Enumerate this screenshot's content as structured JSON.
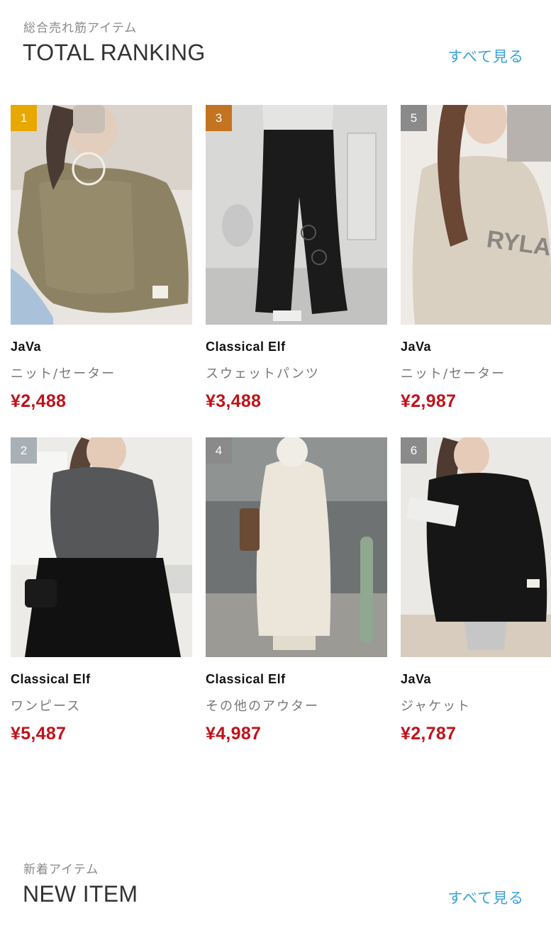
{
  "ranking": {
    "subtitle": "総合売れ筋アイテム",
    "title": "TOTAL RANKING",
    "see_all": "すべて見る",
    "products": [
      {
        "rank": "1",
        "rank_color": "#e8a800",
        "brand": "JaVa",
        "category": "ニット/セーター",
        "price": "¥2,488",
        "image": "olive-knit-sweater"
      },
      {
        "rank": "3",
        "rank_color": "#c47420",
        "brand": "Classical Elf",
        "category": "スウェットパンツ",
        "price": "¥3,488",
        "image": "black-wide-pants"
      },
      {
        "rank": "5",
        "rank_color": "#8a8a8a",
        "brand": "JaVa",
        "category": "ニット/セーター",
        "price": "¥2,987",
        "image": "beige-logo-sweater"
      },
      {
        "rank": "2",
        "rank_color": "#a8b0b6",
        "brand": "Classical Elf",
        "category": "ワンピース",
        "price": "¥5,487",
        "image": "grey-knit-tulle-dress"
      },
      {
        "rank": "4",
        "rank_color": "#8a8a8a",
        "brand": "Classical Elf",
        "category": "その他のアウター",
        "price": "¥4,987",
        "image": "ivory-long-coat"
      },
      {
        "rank": "6",
        "rank_color": "#8a8a8a",
        "brand": "JaVa",
        "category": "ジャケット",
        "price": "¥2,787",
        "image": "black-quilted-jacket"
      }
    ]
  },
  "new_item": {
    "subtitle": "新着アイテム",
    "title": "NEW ITEM",
    "see_all": "すべて見る"
  }
}
